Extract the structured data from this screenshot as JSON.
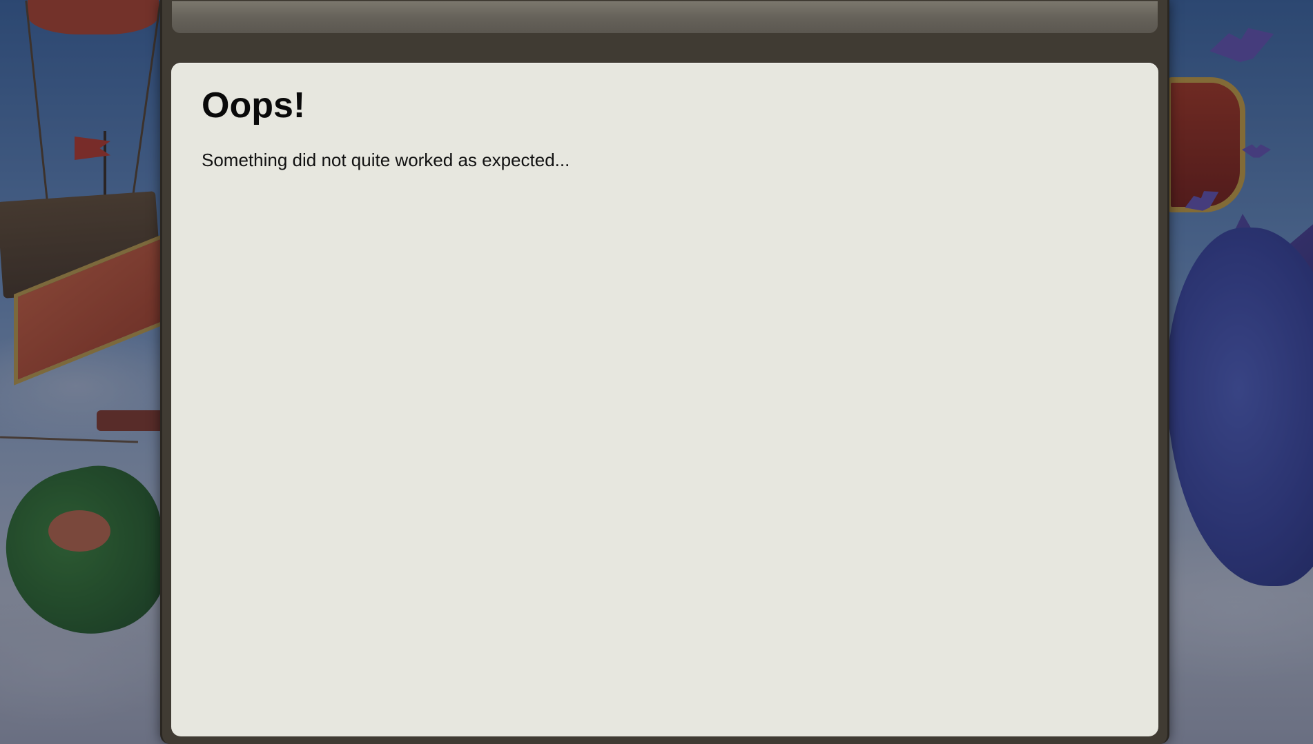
{
  "dialog": {
    "title": "Oops!",
    "message": "Something did not quite worked as expected..."
  },
  "colors": {
    "frame": "#403b33",
    "titlebar": "#6a665d",
    "body": "#e7e7df",
    "text": "#0a0a0a"
  }
}
